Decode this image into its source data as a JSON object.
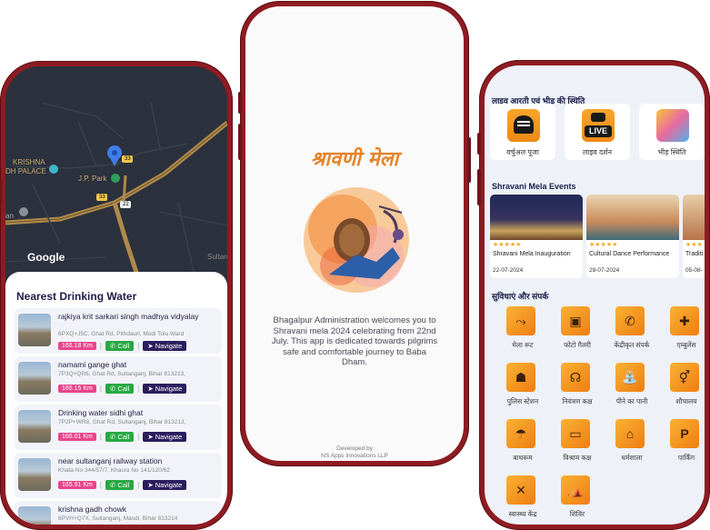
{
  "left_phone": {
    "map": {
      "labels": [
        "KRISHNA",
        "DH PALACE",
        "J.P. Park",
        "an",
        "Sultani"
      ],
      "route_numbers": [
        "33",
        "33",
        "22"
      ],
      "google_logo": "Google"
    },
    "sheet_title": "Nearest Drinking Water",
    "items": [
      {
        "name": "rajkiya krit sarkari singh madhya vidyalay",
        "address": "6PXQ+J5C, Ghat Rd, Pithdauri, Modi Tola Ward",
        "distance": "166.18 Km",
        "call": "Call",
        "navigate": "Navigate"
      },
      {
        "name": "namami  gange  ghat",
        "address": "7P3Q+QR6, Ghat Rd, Sultanganj, Bihar 813213,",
        "distance": "166.15 Km",
        "call": "Call",
        "navigate": "Navigate"
      },
      {
        "name": "Drinking water sidhi ghat",
        "address": "7P2P+WR8, Ghat Rd, Sultanganj, Bihar 813213,",
        "distance": "166.01 Km",
        "call": "Call",
        "navigate": "Navigate"
      },
      {
        "name": "near sultanganj railway station",
        "address": "Khata No 344/57/7, Khasra No 141/120/62",
        "distance": "165.91 Km",
        "call": "Call",
        "navigate": "Navigate"
      },
      {
        "name": "krishna gadh  chowk",
        "address": "6PVH+Q7X, Sultanganj, Masdi, Bihar 813214",
        "distance": "",
        "call": "",
        "navigate": ""
      }
    ],
    "colors": {
      "distance_badge": "#e8458b",
      "call": "#27a843",
      "navigate": "#2b1e5e"
    }
  },
  "middle_phone": {
    "title": "श्रावणी मेला",
    "welcome_text": "Bhagalpur Administration welcomes you to Shravani mela 2024 celebrating from 22nd July. This app is dedicated towards pilgrims safe and comfortable journey to Baba Dham.",
    "developed_by": "Developed by",
    "developer": "NS Apps Innovations LLP"
  },
  "right_phone": {
    "live_section_title": "लाइव आरती एवं भीड़ की स्थिति",
    "live_cards": [
      {
        "label": "वर्चुअल पूजा",
        "icon": "temple-icon"
      },
      {
        "label": "लाइव दर्शन",
        "icon": "live-camera-icon",
        "badge": "LIVE"
      },
      {
        "label": "भीड़ स्थिति",
        "icon": "crowd-icon"
      }
    ],
    "events_title": "Shravani Mela Events",
    "events": [
      {
        "name": "Shravani Mela Inauguration",
        "date": "22-07-2024",
        "stars": "★★★★★"
      },
      {
        "name": "Cultural Dance Performance",
        "date": "29-07-2024",
        "stars": "★★★★★"
      },
      {
        "name": "Traditi",
        "date": "05-08-",
        "stars": "★★★"
      }
    ],
    "services_title": "सुविधाएं और संपर्क",
    "services": [
      {
        "label": "मेला रूट",
        "icon": "route-icon"
      },
      {
        "label": "फोटो गैलरी",
        "icon": "gallery-icon"
      },
      {
        "label": "केंद्रीकृत संपर्क",
        "icon": "phone-icon"
      },
      {
        "label": "एम्बुलेंस",
        "icon": "ambulance-icon"
      },
      {
        "label": "पुलिस स्टेशन",
        "icon": "police-icon"
      },
      {
        "label": "नियंत्रण कक्ष",
        "icon": "headset-icon"
      },
      {
        "label": "पीने का पानी",
        "icon": "water-tap-icon"
      },
      {
        "label": "शौचालय",
        "icon": "toilet-icon"
      },
      {
        "label": "बाथरूम",
        "icon": "shower-icon"
      },
      {
        "label": "विश्राम कक्ष",
        "icon": "bed-icon"
      },
      {
        "label": "धर्मशाला",
        "icon": "dharamshala-icon"
      },
      {
        "label": "पार्किंग",
        "icon": "parking-icon"
      },
      {
        "label": "स्वास्थ्य केंद्र",
        "icon": "health-icon"
      },
      {
        "label": "शिविर",
        "icon": "camp-icon"
      }
    ]
  }
}
